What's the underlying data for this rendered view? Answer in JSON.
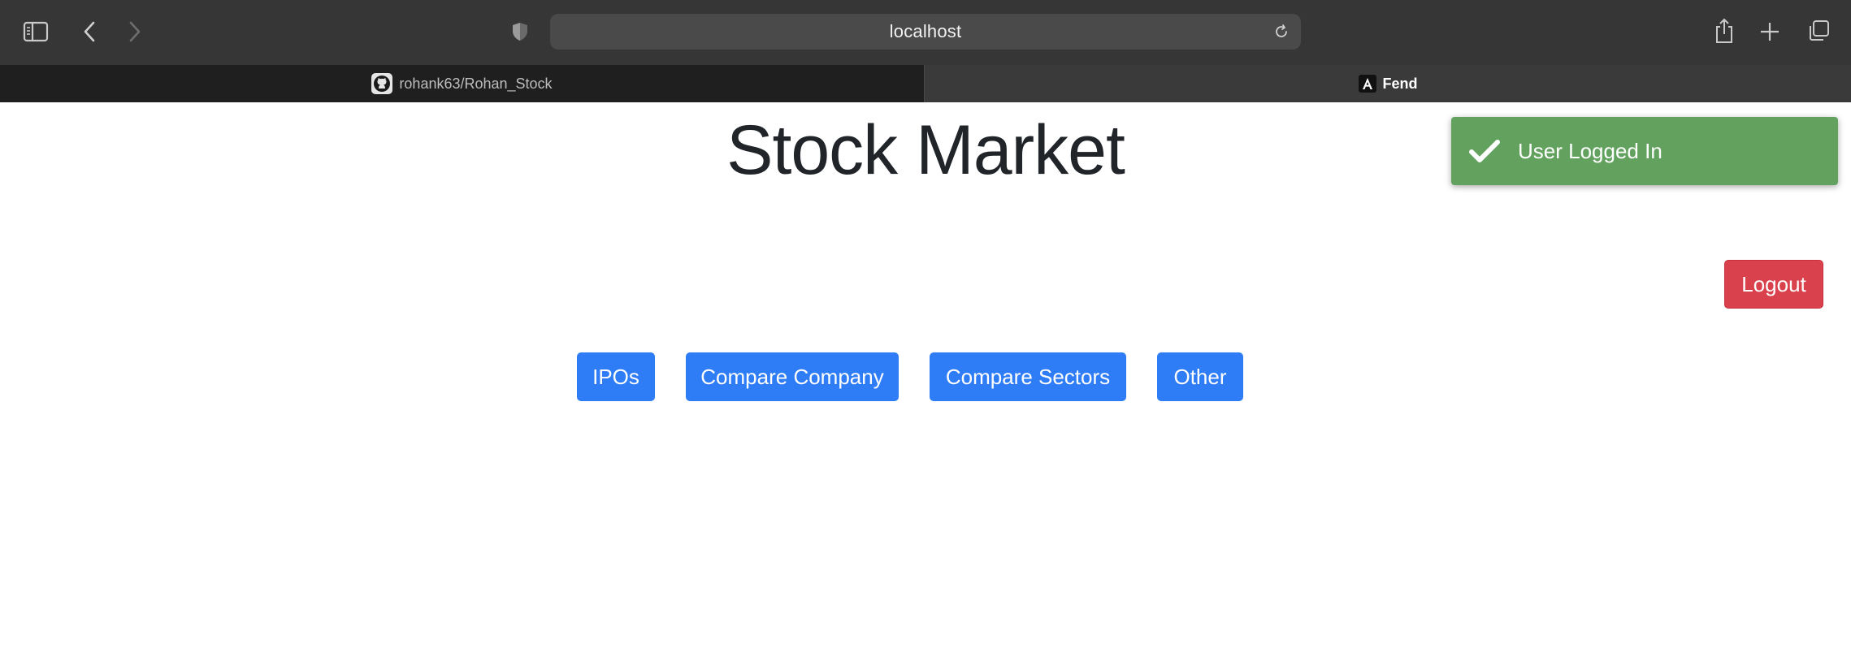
{
  "browser": {
    "url": "localhost",
    "tabs": [
      {
        "label": "rohank63/Rohan_Stock",
        "icon": "github-icon",
        "active": false
      },
      {
        "label": "Fend",
        "icon": "angular-icon",
        "active": true
      }
    ]
  },
  "page": {
    "title": "Stock Market",
    "toast": {
      "message": "User Logged In",
      "icon": "checkmark-icon",
      "color": "#62a25e"
    },
    "logout_label": "Logout",
    "nav_buttons": [
      "IPOs",
      "Compare Company",
      "Compare Sectors",
      "Other"
    ]
  },
  "colors": {
    "primary": "#2f7df6",
    "danger": "#d9414d",
    "success": "#62a25e",
    "chrome": "#363636"
  }
}
